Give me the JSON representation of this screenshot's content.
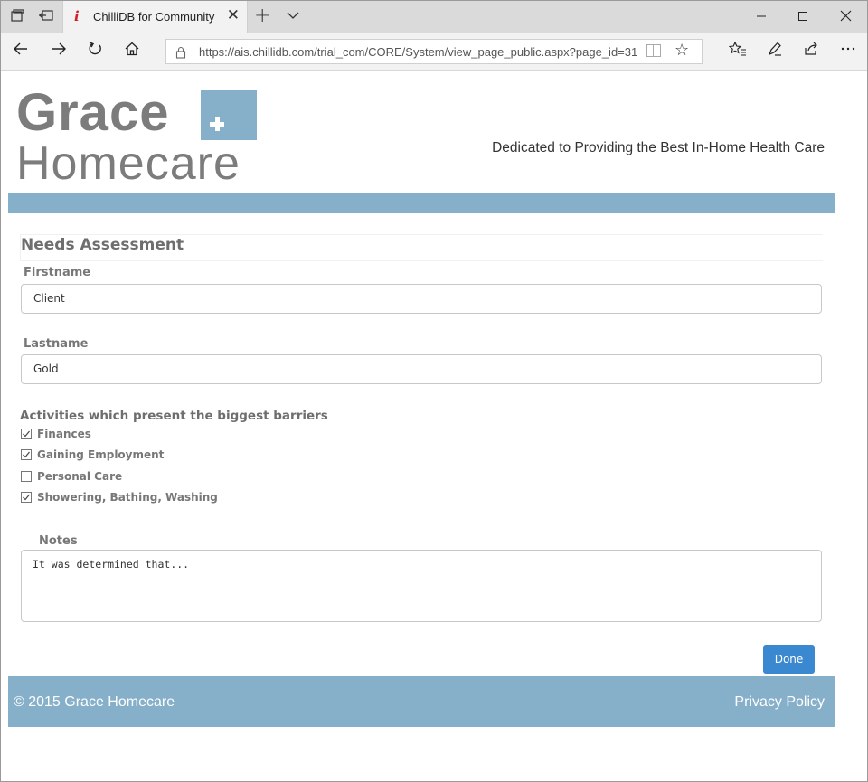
{
  "browser": {
    "tab_title": "ChilliDB for Community",
    "tab_favicon": "i",
    "tab_close": "✕",
    "new_tab": "+",
    "url": "https://ais.chillidb.com/trial_com/CORE/System/view_page_public.aspx?page_id=31",
    "icons": [
      "tab-manager-icon",
      "set-aside-tabs-icon",
      "favicon-icon",
      "close-icon",
      "new-tab-icon",
      "chevron-down-icon",
      "minimize-icon",
      "maximize-icon",
      "close-window-icon",
      "back-icon",
      "forward-icon",
      "refresh-icon",
      "home-icon",
      "lock-icon",
      "reading-view-icon",
      "favorite-star-icon",
      "favorites-hub-icon",
      "notes-pen-icon",
      "share-icon",
      "more-icon"
    ]
  },
  "header": {
    "logo_line1": "Grace",
    "logo_line2": "Homecare",
    "tagline": "Dedicated to Providing the Best In-Home Health Care",
    "accent_color": "#86afc9"
  },
  "form": {
    "title": "Needs Assessment",
    "firstname_label": "Firstname",
    "firstname_value": "Client",
    "lastname_label": "Lastname",
    "lastname_value": "Gold",
    "barriers_label": "Activities which present the biggest barriers",
    "barriers": [
      {
        "label": "Finances",
        "checked": true
      },
      {
        "label": "Gaining Employment",
        "checked": true
      },
      {
        "label": "Personal Care",
        "checked": false
      },
      {
        "label": "Showering, Bathing, Washing",
        "checked": true
      }
    ],
    "notes_label": "Notes",
    "notes_value": "It was determined that...",
    "done_label": "Done",
    "done_color": "#3a88d0"
  },
  "footer": {
    "copyright": "© 2015 Grace Homecare",
    "privacy": "Privacy Policy"
  }
}
